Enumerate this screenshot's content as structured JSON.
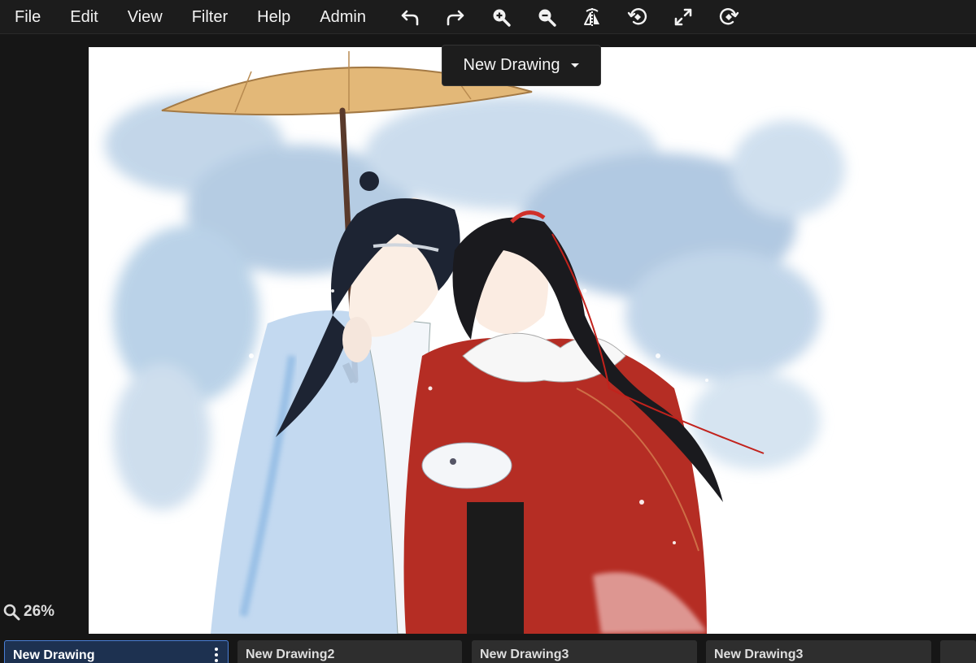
{
  "menubar": {
    "items": [
      {
        "label": "File"
      },
      {
        "label": "Edit"
      },
      {
        "label": "View"
      },
      {
        "label": "Filter"
      },
      {
        "label": "Help"
      },
      {
        "label": "Admin"
      }
    ],
    "tools": [
      "undo-icon",
      "redo-icon",
      "zoom-in-icon",
      "zoom-out-icon",
      "flip-horizontal-icon",
      "rotate-left-icon",
      "fullscreen-icon",
      "rotate-right-icon"
    ]
  },
  "drawing_selector": {
    "label": "New Drawing"
  },
  "zoom": {
    "value": "26%"
  },
  "tabs": [
    {
      "label": "New Drawing",
      "active": true
    },
    {
      "label": "New Drawing2",
      "active": false
    },
    {
      "label": "New Drawing3",
      "active": false
    },
    {
      "label": "New Drawing3",
      "active": false
    }
  ],
  "colors": {
    "background": "#161616",
    "menubar": "#1c1c1c",
    "active_tab": "#1d3150",
    "active_tab_border": "#4a7fd6",
    "tab": "#2e2e2e"
  }
}
